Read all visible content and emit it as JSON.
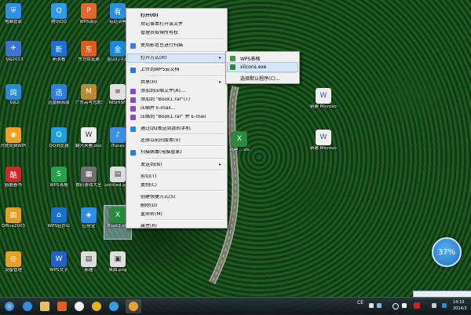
{
  "desktop": {
    "icons": [
      {
        "label": "电脑管家",
        "color": "#2e8ee8",
        "glyph": "⛨"
      },
      {
        "label": "腾讯QQ",
        "color": "#2f9be8",
        "glyph": "Q"
      },
      {
        "label": "WPS演示",
        "color": "#e0682c",
        "glyph": "P"
      },
      {
        "label": "有道词典",
        "color": "#2c8ee0",
        "glyph": "有"
      },
      {
        "label": "飞鸽2013",
        "color": "#3c74d0",
        "glyph": "✈"
      },
      {
        "label": "新浪看",
        "color": "#1e6fd4",
        "glyph": "新"
      },
      {
        "label": "东方财富通",
        "color": "#e25b1c",
        "glyph": "东"
      },
      {
        "label": "金山打字通",
        "color": "#1d86d6",
        "glyph": "金"
      },
      {
        "label": "飞鸽2",
        "color": "#2a8ad6",
        "glyph": "鸽"
      },
      {
        "label": "迅雷精简版",
        "color": "#2d7fd9",
        "glyph": "迅"
      },
      {
        "label": "广东高考志愿辅",
        "color": "#b88b2c",
        "glyph": "M"
      },
      {
        "label": "NISHISH",
        "color": "#e0e0e0",
        "glyph": "≡"
      },
      {
        "label": "开放免费WiFi",
        "color": "#f0a020",
        "glyph": "◉"
      },
      {
        "label": "QQ浏览器",
        "color": "#1ea0e0",
        "glyph": "Q"
      },
      {
        "label": "翻开来看.doc",
        "color": "#eeeeee",
        "glyph": "W"
      },
      {
        "label": "iTunes",
        "color": "#3b8fe6",
        "glyph": "♪"
      },
      {
        "label": "超酷看书",
        "color": "#cc2a2a",
        "glyph": "酷"
      },
      {
        "label": "WPS表格",
        "color": "#2aa04a",
        "glyph": "S"
      },
      {
        "label": "数码游戏大全",
        "color": "#707070",
        "glyph": "▦"
      },
      {
        "label": "untitled.png",
        "color": "#dddddd",
        "glyph": "▤"
      },
      {
        "label": "Office2003",
        "color": "#e0a020",
        "glyph": "▥"
      },
      {
        "label": "WPS轻办公",
        "color": "#1a70c8",
        "glyph": "⌂"
      },
      {
        "label": "应用宝",
        "color": "#2b8de8",
        "glyph": "◈"
      },
      {
        "label": "Book1.xls",
        "color": "#2a8a3c",
        "glyph": "X"
      },
      {
        "label": "设备管理",
        "color": "#e8a020",
        "glyph": "◎"
      },
      {
        "label": "WPS文字",
        "color": "#2060c8",
        "glyph": "W"
      },
      {
        "label": "新建",
        "color": "#dddddd",
        "glyph": "▤"
      },
      {
        "label": "桌面.png",
        "color": "#dddddd",
        "glyph": "▣"
      }
    ],
    "right_icons": [
      {
        "label": "新建 Microsoft...",
        "color": "#eeeeee",
        "glyph": "W"
      },
      {
        "label": "新建 Microsoft...",
        "color": "#eeeeee",
        "glyph": "W"
      }
    ],
    "mid_icon": {
      "label": "新建 ...xls",
      "color": "#2a8a3c",
      "glyph": "X"
    }
  },
  "context_menu": {
    "items": [
      {
        "label": "打开(O)",
        "bold": true,
        "icon": "",
        "arrow": ""
      },
      {
        "label": "用记事本打开该文件",
        "icon": "",
        "arrow": ""
      },
      {
        "label": "管理员取得所有权",
        "icon": "",
        "arrow": ""
      },
      {
        "label": "使用影音豆进行扫描",
        "icon": "#3b7fd6",
        "arrow": ""
      },
      {
        "label": "打开方式(H)",
        "icon": "",
        "arrow": "▸",
        "highlight": true
      },
      {
        "label": "上传到WPS云文档",
        "icon": "#2a7ad6",
        "arrow": ""
      },
      {
        "label": "共享(H)",
        "icon": "",
        "arrow": "▸"
      },
      {
        "label": "添加到压缩文件(A)...",
        "icon": "#8a4ac0",
        "arrow": ""
      },
      {
        "label": "添加到 \"Book1.rar\"(T)",
        "icon": "#8a4ac0",
        "arrow": ""
      },
      {
        "label": "压缩并 E-mail...",
        "icon": "#8a4ac0",
        "arrow": ""
      },
      {
        "label": "压缩到 \"Book1.rar\" 并 E-mail",
        "icon": "#8a4ac0",
        "arrow": ""
      },
      {
        "label": "通过QQ发送到我的手机",
        "icon": "#2a88e0",
        "arrow": ""
      },
      {
        "label": "还原以前的版本(V)",
        "icon": "",
        "arrow": ""
      },
      {
        "label": "扫描病毒(电脑管家)",
        "icon": "#2a80e0",
        "arrow": ""
      },
      {
        "label": "发送到(N)",
        "icon": "",
        "arrow": "▸"
      },
      {
        "label": "剪切(T)",
        "icon": "",
        "arrow": ""
      },
      {
        "label": "复制(C)",
        "icon": "",
        "arrow": ""
      },
      {
        "label": "创建快捷方式(S)",
        "icon": "",
        "arrow": ""
      },
      {
        "label": "删除(D)",
        "icon": "",
        "arrow": ""
      },
      {
        "label": "重命名(M)",
        "icon": "",
        "arrow": ""
      },
      {
        "label": "属性(R)",
        "icon": "",
        "arrow": ""
      }
    ],
    "submenu": [
      {
        "label": "WPS表格",
        "icon": "#2aa04a"
      },
      {
        "label": "xlicons.exe",
        "icon": "#2a8a3c",
        "highlight": true
      },
      {
        "label": "选择默认程序(C)...",
        "icon": ""
      }
    ]
  },
  "widget": {
    "percent": "37%"
  },
  "taskbar": {
    "tray_label": "CE",
    "clock_time": "14:10",
    "clock_date": "2014/3"
  },
  "colors": {
    "accent": "#d5e6f7",
    "menu_bg": "#f0f0f0",
    "taskbar": "#1b232b"
  }
}
